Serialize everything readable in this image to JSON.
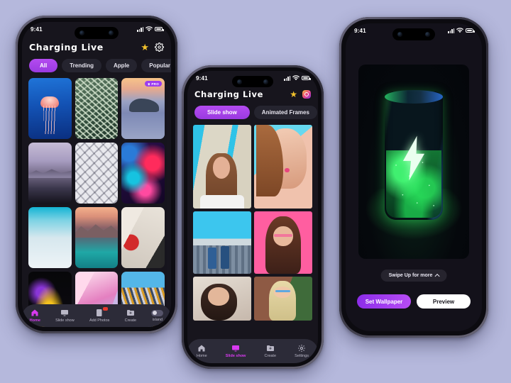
{
  "canvas": {
    "background": "#b5b8dc"
  },
  "phone_left": {
    "status": {
      "time": "9:41",
      "signal_icon": "signal-bars-icon",
      "wifi_icon": "wifi-icon",
      "battery_icon": "battery-icon"
    },
    "header": {
      "title": "Charging Live",
      "star_icon": "star-icon",
      "settings_icon": "gear-icon"
    },
    "chips": [
      {
        "label": "All",
        "active": true
      },
      {
        "label": "Trending",
        "active": false
      },
      {
        "label": "Apple",
        "active": false
      },
      {
        "label": "Popular",
        "active": false
      }
    ],
    "badge": {
      "label": "PRO",
      "crown_icon": "crown-icon",
      "color": "#9c3df0"
    },
    "wallpapers": [
      {
        "name": "jellyfish",
        "pro": false,
        "c1": "#1b6fd6",
        "c2": "#0b3d94",
        "c3": "#ff9a8b"
      },
      {
        "name": "green-coral-texture",
        "pro": false,
        "c1": "#7d9a7e",
        "c2": "#2e4a3c",
        "c3": "#b9cdb4"
      },
      {
        "name": "sea-rock-sunset",
        "pro": true,
        "c1": "#f0b37a",
        "c2": "#7e8fc0",
        "c3": "#3a4a62"
      },
      {
        "name": "purple-mountain-lake",
        "pro": false,
        "c1": "#b9aecd",
        "c2": "#5c5570",
        "c3": "#2b2838"
      },
      {
        "name": "white-3d-mesh",
        "pro": false,
        "c1": "#ffffff",
        "c2": "#cfcfcf",
        "c3": "#8f8f94"
      },
      {
        "name": "neon-coral-reef",
        "pro": false,
        "c1": "#ff2f5e",
        "c2": "#10b6d8",
        "c3": "#2a0f4a"
      },
      {
        "name": "frozen-glacier",
        "pro": false,
        "c1": "#12b0d0",
        "c2": "#cfe6ef",
        "c3": "#e8f2f6"
      },
      {
        "name": "mountain-reflection",
        "pro": false,
        "c1": "#f0a98a",
        "c2": "#7d5c62",
        "c3": "#1fa9a5"
      },
      {
        "name": "graffiti-collage",
        "pro": false,
        "c1": "#e8e3dc",
        "c2": "#d12b2b",
        "c3": "#2a2a2a"
      },
      {
        "name": "night-fireworks-car",
        "pro": false,
        "c1": "#f2c020",
        "c2": "#7b2fd0",
        "c3": "#060608"
      },
      {
        "name": "pink-marble-fluid",
        "pro": false,
        "c1": "#ffd7ea",
        "c2": "#d56ab4",
        "c3": "#b6b9e8"
      },
      {
        "name": "golden-city-rooftops",
        "pro": false,
        "c1": "#57b7e8",
        "c2": "#d9952a",
        "c3": "#2f4a6b"
      }
    ],
    "tabs": [
      {
        "label": "Home",
        "icon": "home-icon",
        "active": true,
        "badge": false
      },
      {
        "label": "Slide show",
        "icon": "slideshow-icon",
        "active": false,
        "badge": false
      },
      {
        "label": "Add Photos",
        "icon": "add-photos-icon",
        "active": false,
        "badge": true
      },
      {
        "label": "Create",
        "icon": "create-folder-icon",
        "active": false,
        "badge": false
      },
      {
        "label": "island",
        "icon": "toggle-switch-icon",
        "active": false,
        "badge": false
      }
    ]
  },
  "phone_center": {
    "status": {
      "time": "9:41"
    },
    "header": {
      "title": "Charging Live",
      "star_icon": "star-icon",
      "instagram_icon": "instagram-icon"
    },
    "segments": [
      {
        "label": "Slide show",
        "active": true
      },
      {
        "label": "Animated Frames",
        "active": false
      }
    ],
    "photos": [
      {
        "name": "girl-blue-wall",
        "c1": "#2fc3e8",
        "c2": "#d9d4c4",
        "c3": "#8a5a3c"
      },
      {
        "name": "girl-glitter-makeup",
        "c1": "#5fd7ef",
        "c2": "#f2cbb8",
        "c3": "#b05a44"
      },
      {
        "name": "friends-city-rooftop",
        "c1": "#37c4ee",
        "c2": "#d7dde2",
        "c3": "#3a6fa0"
      },
      {
        "name": "girl-pink-sunglasses",
        "c1": "#ff5ea0",
        "c2": "#6b3a2a",
        "c3": "#2a1a18"
      },
      {
        "name": "two-girls-lying",
        "c1": "#e8e2da",
        "c2": "#7a5a4a",
        "c3": "#2a2220"
      },
      {
        "name": "girl-brick-wall",
        "c1": "#9a5a46",
        "c2": "#cfd7dd",
        "c3": "#3f6b3a"
      }
    ],
    "tabs": [
      {
        "label": "Home",
        "icon": "home-icon",
        "active": false
      },
      {
        "label": "Slide show",
        "icon": "slideshow-icon",
        "active": true
      },
      {
        "label": "Create",
        "icon": "create-folder-icon",
        "active": false
      },
      {
        "label": "Settings",
        "icon": "gear-icon",
        "active": false
      }
    ]
  },
  "phone_right": {
    "status": {
      "time": "9:41"
    },
    "hero": {
      "name": "charging-battery-glow",
      "glow_color": "#2fe05a",
      "bolt_icon": "lightning-bolt-icon"
    },
    "swipe_hint": {
      "label": "Swipe Up for more",
      "icon": "chevron-up-icon"
    },
    "buttons": [
      {
        "label": "Set Wallpaper",
        "style": "primary"
      },
      {
        "label": "Preview",
        "style": "ghost"
      }
    ]
  }
}
